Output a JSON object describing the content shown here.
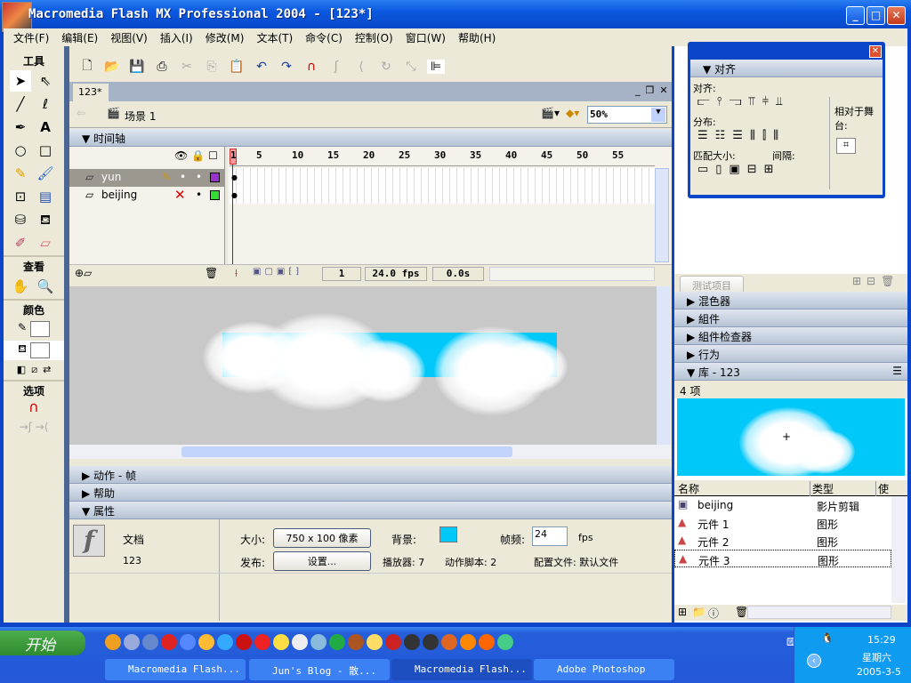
{
  "window": {
    "title": "Macromedia Flash MX Professional 2004 - [123*]",
    "minimize": "_",
    "maximize": "□",
    "close": "✕"
  },
  "menu": [
    "文件(F)",
    "编辑(E)",
    "视图(V)",
    "插入(I)",
    "修改(M)",
    "文本(T)",
    "命令(C)",
    "控制(O)",
    "窗口(W)",
    "帮助(H)"
  ],
  "tools": {
    "title": "工具",
    "view": "查看",
    "colors": "颜色",
    "options": "选项"
  },
  "document": {
    "tab": "123*",
    "scene": "场景 1",
    "zoom": "50%"
  },
  "timeline": {
    "title": "时间轴",
    "layers": [
      {
        "name": "yun",
        "color": "#9933cc"
      },
      {
        "name": "beijing",
        "color": "#33dd33"
      }
    ],
    "ruler": [
      "1",
      "5",
      "10",
      "15",
      "20",
      "25",
      "30",
      "35",
      "40",
      "45",
      "50",
      "55"
    ],
    "current_frame": "1",
    "fps": "24.0 fps",
    "time": "0.0s"
  },
  "panels": {
    "actions": "动作 - 帧",
    "help": "帮助",
    "properties": "属性"
  },
  "properties": {
    "type": "文档",
    "name": "123",
    "size_label": "大小:",
    "size": "750 x 100 像素",
    "bg_label": "背景:",
    "bg_color": "#00c8f8",
    "fps_label": "帧频:",
    "fps": "24",
    "fps_unit": "fps",
    "publish_label": "发布:",
    "settings": "设置...",
    "player": "播放器: 7",
    "actionscript": "动作脚本:  2",
    "profile": "配置文件: 默认文件"
  },
  "align": {
    "title": "对齐",
    "align": "对齐:",
    "distribute": "分布:",
    "match": "匹配大小:",
    "space": "间隔:",
    "to_stage": "相对于舞台:"
  },
  "right": {
    "test": "测试项目",
    "mixer": "混色器",
    "components": "組件",
    "inspector": "組件检查器",
    "behaviors": "行为",
    "library": "库 - 123",
    "count": "4 项",
    "columns": [
      "名称",
      "类型",
      "使"
    ],
    "items": [
      {
        "name": "beijing",
        "type": "影片剪辑"
      },
      {
        "name": "元件 1",
        "type": "图形"
      },
      {
        "name": "元件 2",
        "type": "图形"
      },
      {
        "name": "元件 3",
        "type": "图形"
      }
    ]
  },
  "taskbar": {
    "start": "开始",
    "tasks": [
      "Macromedia Flash...",
      "Jun's Blog - 散...",
      "Macromedia Flash...",
      "Adobe Photoshop"
    ],
    "time": "15:29",
    "weekday": "星期六",
    "date": "2005-3-5"
  }
}
